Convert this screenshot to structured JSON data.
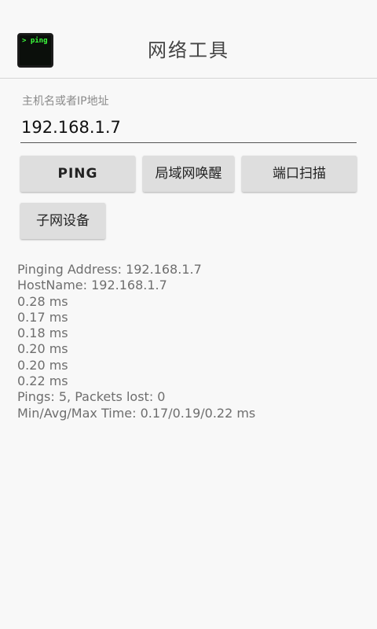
{
  "app": {
    "icon_text": "> ping",
    "title": "网络工具"
  },
  "host": {
    "label": "主机名或者IP地址",
    "value": "192.168.1.7"
  },
  "buttons": {
    "ping": "PING",
    "wol": "局域网唤醒",
    "port_scan": "端口扫描",
    "subnet_devices": "子网设备"
  },
  "output": {
    "lines": [
      "Pinging Address: 192.168.1.7",
      "HostName: 192.168.1.7",
      "0.28 ms",
      "0.17 ms",
      "0.18 ms",
      "0.20 ms",
      "0.20 ms",
      "0.22 ms",
      "Pings: 5, Packets lost: 0",
      "Min/Avg/Max Time: 0.17/0.19/0.22 ms"
    ]
  }
}
